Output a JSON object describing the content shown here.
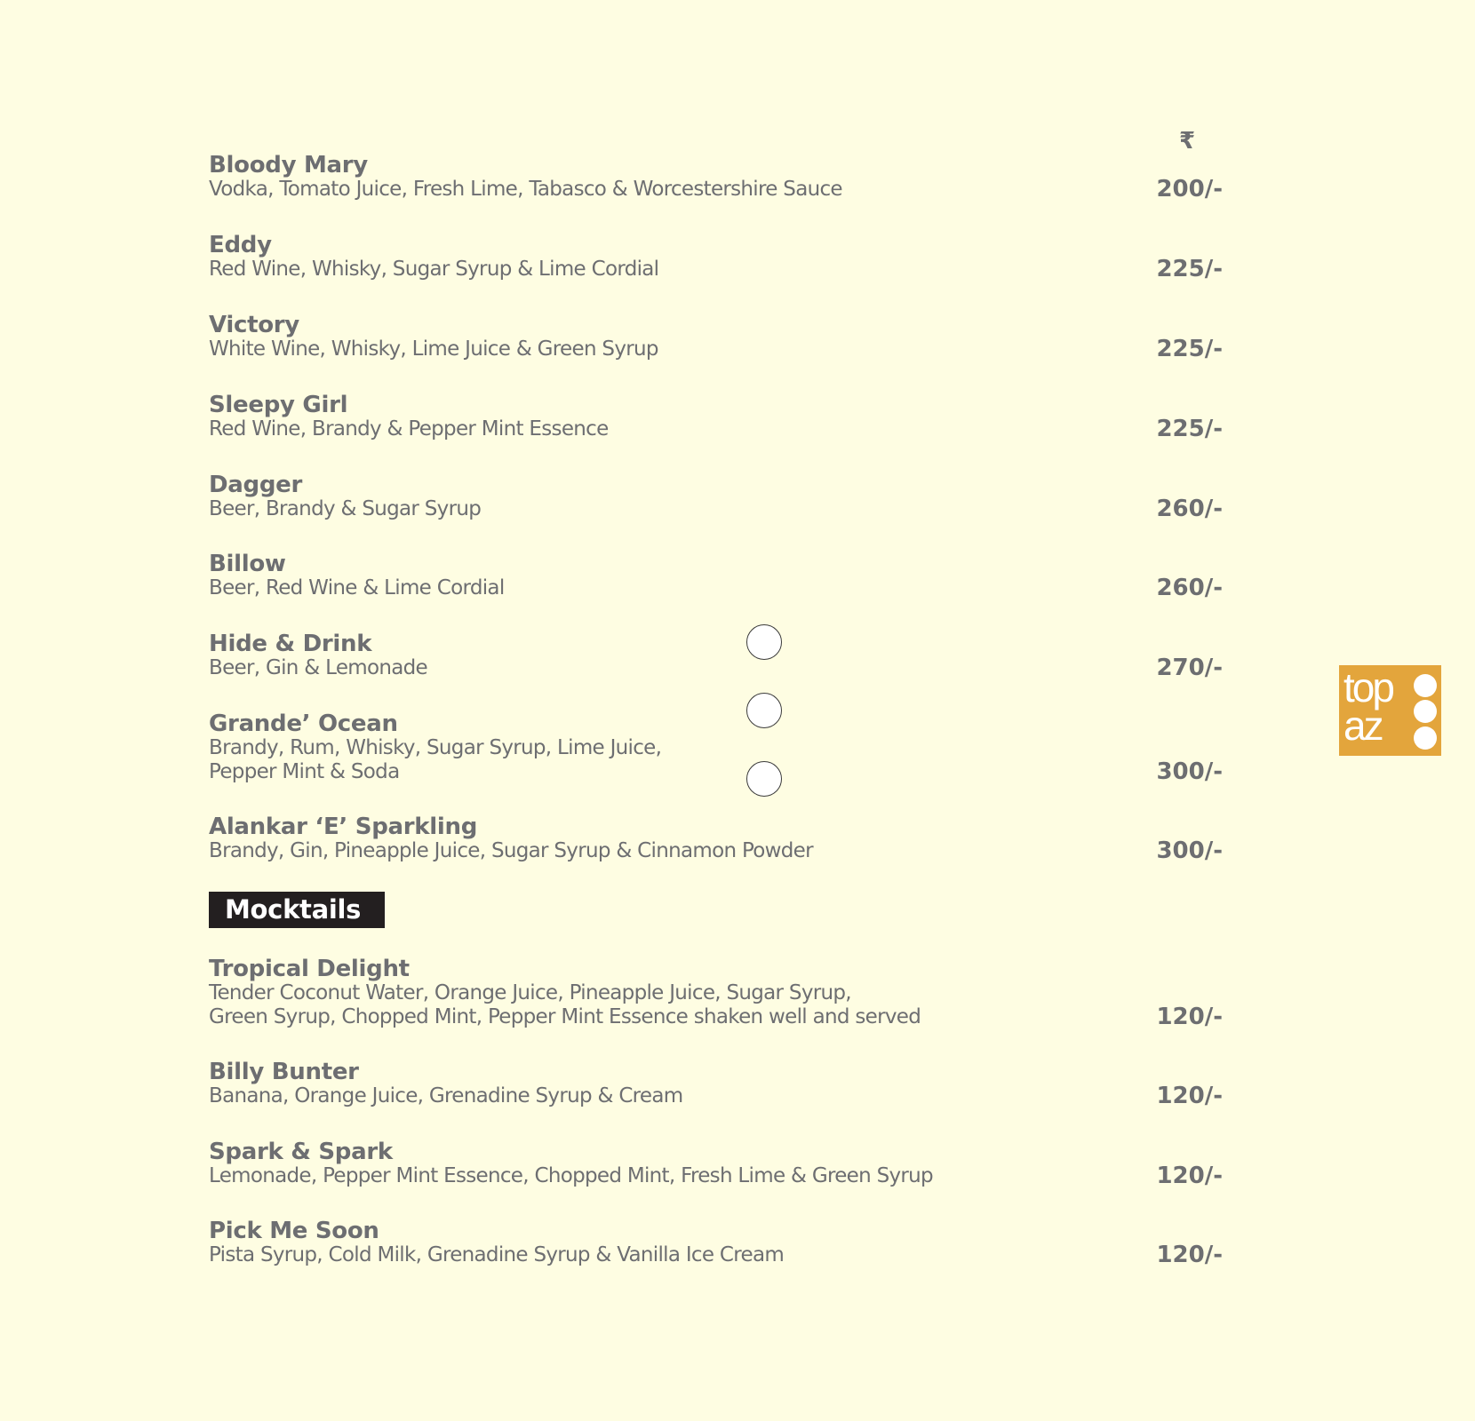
{
  "currency_symbol": "₹",
  "cocktails": [
    {
      "name": "Bloody Mary",
      "desc": [
        "Vodka, Tomato Juice, Fresh Lime, Tabasco & Worcestershire Sauce"
      ],
      "price": "200/-"
    },
    {
      "name": "Eddy",
      "desc": [
        "Red Wine, Whisky, Sugar Syrup & Lime Cordial"
      ],
      "price": "225/-"
    },
    {
      "name": "Victory",
      "desc": [
        "White Wine, Whisky, Lime Juice & Green Syrup"
      ],
      "price": "225/-"
    },
    {
      "name": "Sleepy Girl",
      "desc": [
        "Red Wine, Brandy & Pepper Mint Essence"
      ],
      "price": "225/-"
    },
    {
      "name": "Dagger",
      "desc": [
        "Beer, Brandy & Sugar Syrup"
      ],
      "price": "260/-"
    },
    {
      "name": "Billow",
      "desc": [
        "Beer, Red Wine & Lime Cordial"
      ],
      "price": "260/-"
    },
    {
      "name": "Hide & Drink",
      "desc": [
        "Beer, Gin & Lemonade"
      ],
      "price": "270/-"
    },
    {
      "name": "Grande’ Ocean",
      "desc": [
        "Brandy, Rum, Whisky, Sugar Syrup, Lime Juice,",
        "Pepper Mint & Soda"
      ],
      "price": "300/-"
    },
    {
      "name": "Alankar ‘E’ Sparkling",
      "desc": [
        "Brandy, Gin, Pineapple Juice, Sugar Syrup & Cinnamon Powder"
      ],
      "price": "300/-"
    }
  ],
  "mocktails_heading": "Mocktails",
  "mocktails": [
    {
      "name": "Tropical Delight",
      "desc": [
        "Tender Coconut Water, Orange Juice, Pineapple Juice, Sugar Syrup,",
        "Green Syrup, Chopped Mint, Pepper Mint Essence shaken well and served"
      ],
      "price": "120/-"
    },
    {
      "name": "Billy Bunter",
      "desc": [
        "Banana, Orange Juice, Grenadine Syrup & Cream"
      ],
      "price": "120/-"
    },
    {
      "name": "Spark & Spark",
      "desc": [
        "Lemonade, Pepper Mint Essence, Chopped Mint, Fresh Lime & Green Syrup"
      ],
      "price": "120/-"
    },
    {
      "name": "Pick Me Soon",
      "desc": [
        "Pista Syrup, Cold Milk, Grenadine Syrup & Vanilla Ice Cream"
      ],
      "price": "120/-"
    }
  ],
  "logo": {
    "line1": "top",
    "line2": "az",
    "color": "#e3a53c"
  },
  "colors": {
    "background": "#fefde2",
    "text": "#6d6e71",
    "heading_bg": "#231f20",
    "heading_text": "#ffffff"
  }
}
